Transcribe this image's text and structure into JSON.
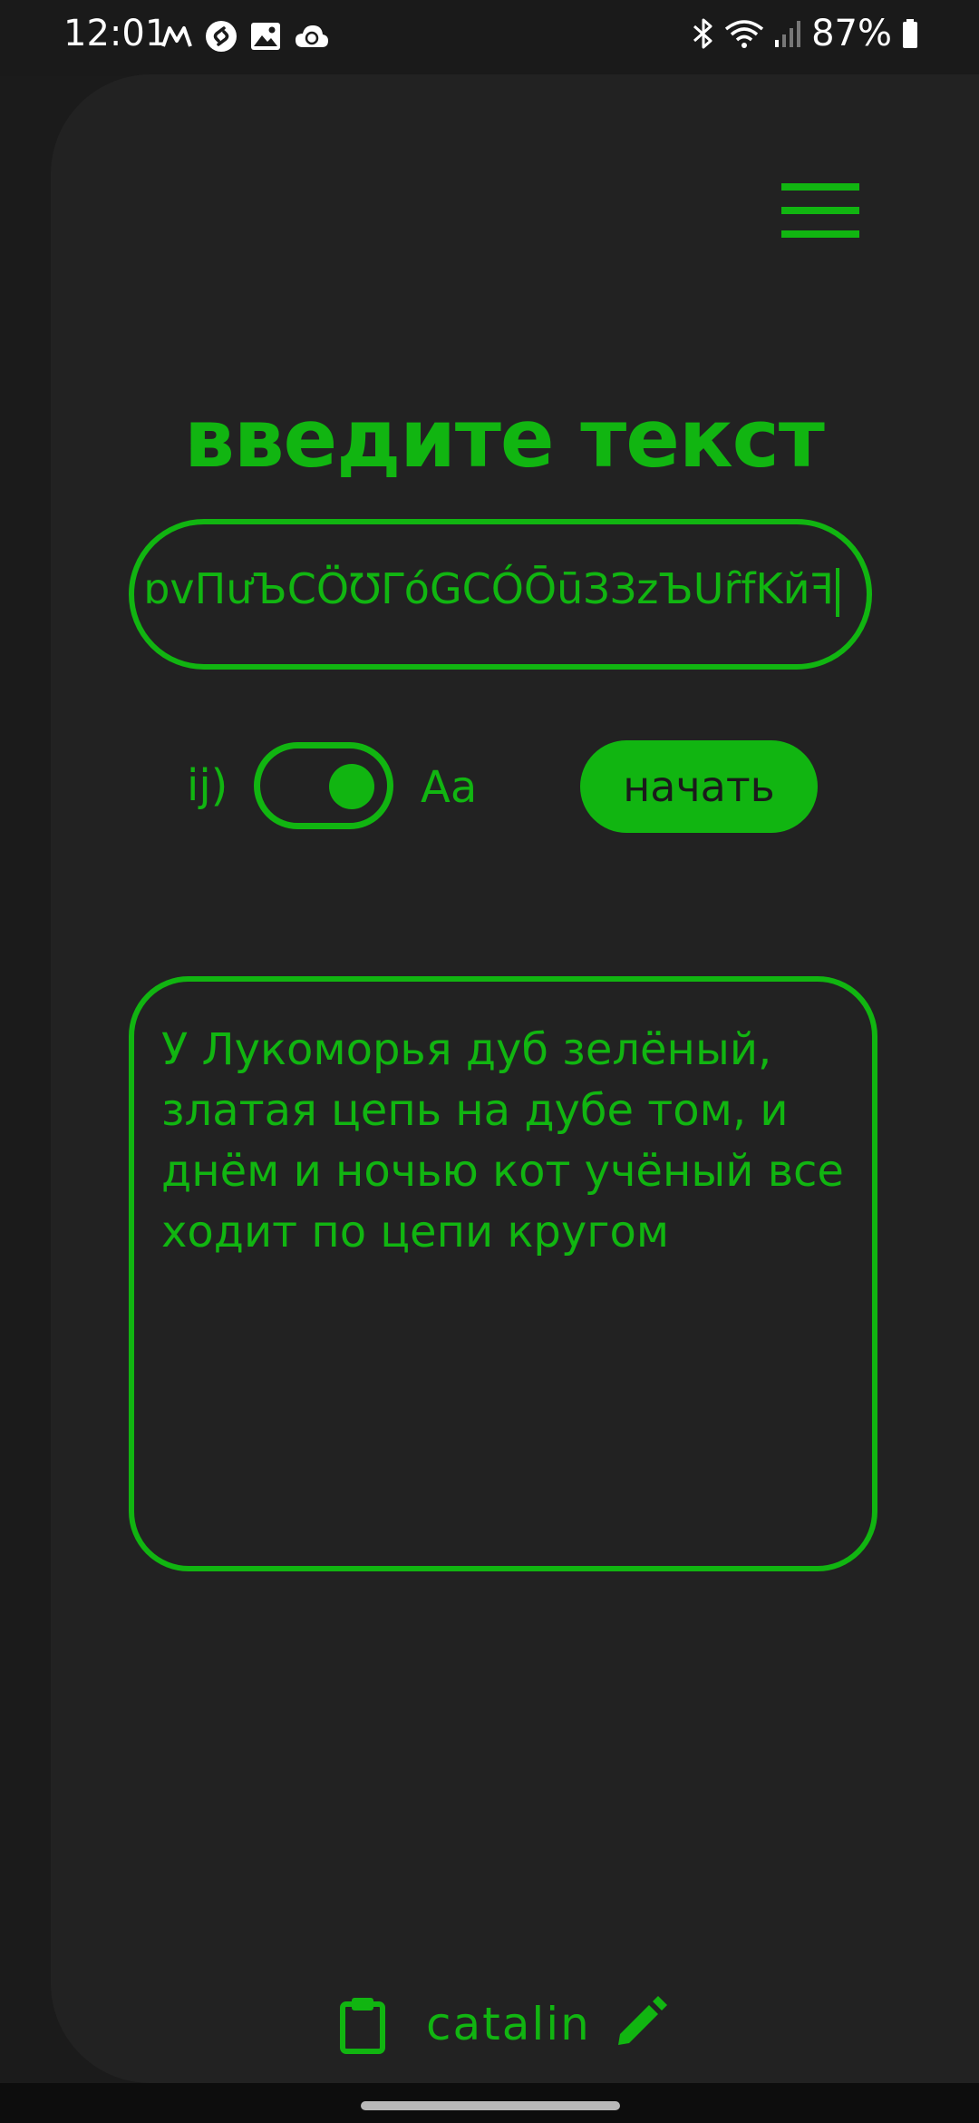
{
  "status_bar": {
    "time": "12:01",
    "left_icons": [
      "m-logo-icon",
      "shazam-icon",
      "gallery-icon",
      "cloud-icon"
    ],
    "right_icons": [
      "bluetooth-icon",
      "wifi-icon",
      "signal-icon",
      "battery-icon"
    ],
    "battery_percent": "87%"
  },
  "header": {
    "menu_icon": "hamburger-menu-icon"
  },
  "main": {
    "heading": "введите текст",
    "input_value": "ɒvПưЪCÖƱΓóGCÓŌūЗЗzЪUȓfKйꟻ",
    "toggle": {
      "left_label": "ij)",
      "right_label": "Aa",
      "on": true
    },
    "start_label": "начать",
    "textarea_value": "У Лукоморья дуб зелёный, златая цепь на дубе том, и днём и ночью кот учёный все ходит по цепи кругом"
  },
  "footer": {
    "username": "catalin",
    "left_icon": "clipboard-icon",
    "right_icon": "edit-pencil-icon"
  },
  "colors": {
    "accent": "#11b511",
    "background": "#1b1b1b",
    "panel": "#222222"
  }
}
